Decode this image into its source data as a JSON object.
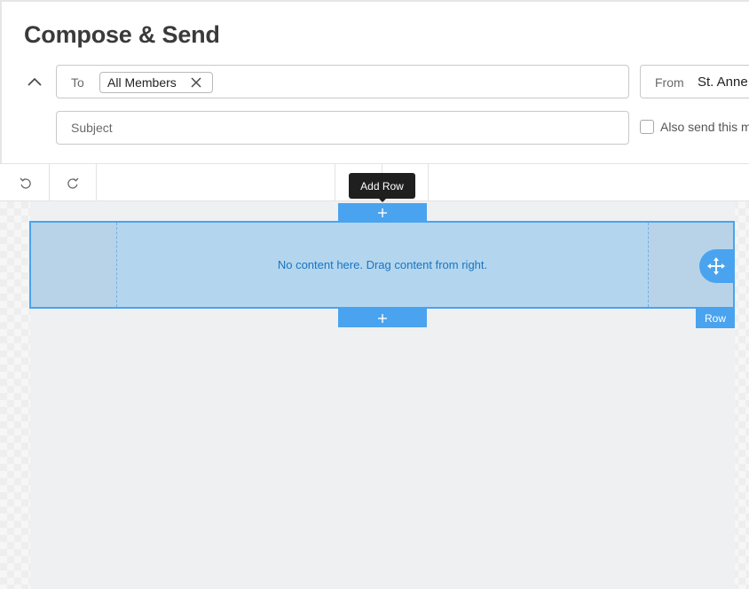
{
  "header": {
    "title": "Compose & Send"
  },
  "recipients": {
    "to_label": "To",
    "chips": [
      {
        "label": "All Members"
      }
    ],
    "from_label": "From",
    "from_value": "St. Anne",
    "subject_placeholder": "Subject",
    "subject_value": "",
    "also_send_label": "Also send this m",
    "also_send_checked": false
  },
  "toolbar": {
    "undo_icon": "undo-icon",
    "redo_icon": "redo-icon"
  },
  "editor": {
    "tooltip": "Add Row",
    "row_placeholder": "No content here. Drag content from right.",
    "row_tag": "Row",
    "accent_color": "#4aa3ef",
    "row_fill_color": "#b3d6ee",
    "placeholder_text_color": "#1a74c2"
  }
}
